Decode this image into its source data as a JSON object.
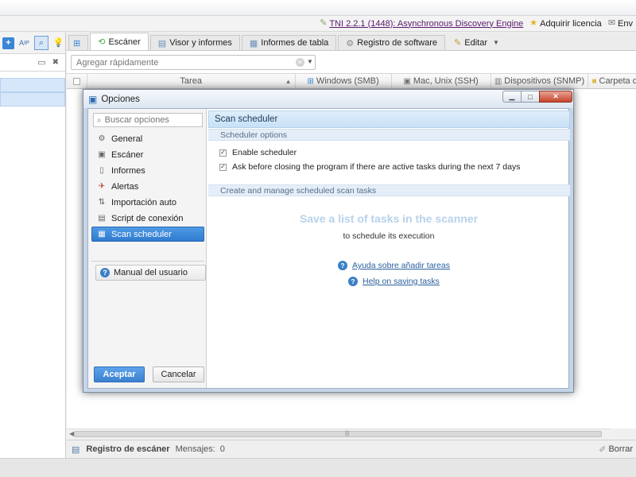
{
  "topbar": {
    "title_link": "TNI 2.2.1 (1448): Asynchronous Discovery Engine",
    "buy_label": "Adquirir licencia",
    "mail_label": "Env"
  },
  "icons": {
    "title": "feather-icon",
    "buy": "star-icon",
    "mail": "envelope-icon"
  },
  "tabs": [
    {
      "label": "",
      "icon": "tab-icon"
    },
    {
      "label": "Escáner",
      "icon": "scanner-icon"
    },
    {
      "label": "Visor y informes",
      "icon": "viewer-icon"
    },
    {
      "label": "Informes de tabla",
      "icon": "table-icon"
    },
    {
      "label": "Registro de software",
      "icon": "software-icon"
    },
    {
      "label": "Editar",
      "icon": "pencil-icon"
    }
  ],
  "quick_add": {
    "placeholder": "Agregar rápidamente"
  },
  "grid": {
    "columns": [
      "Tarea",
      "Windows (SMB)",
      "Mac, Unix (SSH)",
      "Dispositivos (SNMP)",
      "Carpeta de"
    ]
  },
  "status": {
    "log_title": "Registro de escáner",
    "messages_label": "Mensajes:",
    "messages_count": "0",
    "clear_label": "Borrar"
  },
  "dialog": {
    "title": "Opciones",
    "search_placeholder": "Buscar opciones",
    "nav": [
      {
        "label": "General",
        "icon": "gear-icon"
      },
      {
        "label": "Escáner",
        "icon": "scanner-icon"
      },
      {
        "label": "Informes",
        "icon": "report-icon"
      },
      {
        "label": "Alertas",
        "icon": "pin-icon"
      },
      {
        "label": "Importación auto",
        "icon": "import-icon"
      },
      {
        "label": "Script de conexión",
        "icon": "script-icon"
      },
      {
        "label": "Scan scheduler",
        "icon": "calendar-icon"
      }
    ],
    "selected_nav": "Scan scheduler",
    "manual_label": "Manual del usuario",
    "ok_label": "Aceptar",
    "cancel_label": "Cancelar",
    "panel_title": "Scan scheduler",
    "options_header": "Scheduler options",
    "checkboxes": [
      {
        "label": "Enable scheduler",
        "checked": true
      },
      {
        "label": "Ask before closing the program if there are active tasks during the next 7 days",
        "checked": true
      }
    ],
    "manage_header": "Create and manage scheduled scan tasks",
    "empty_title": "Save a list of tasks in the scanner",
    "empty_subtitle": "to schedule its execution",
    "links": [
      "Ayuda sobre añadir tareas",
      "Help on saving tasks"
    ]
  }
}
